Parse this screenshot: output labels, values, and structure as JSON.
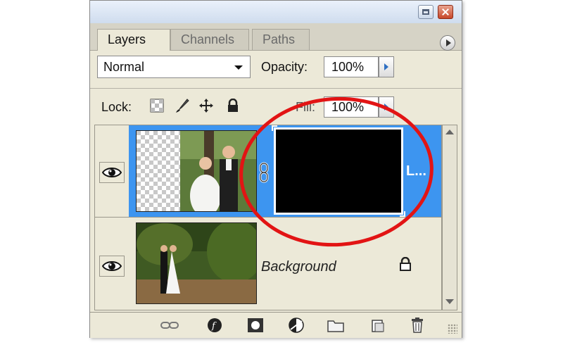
{
  "panel": {
    "tabs": [
      {
        "label": "Layers",
        "active": true
      },
      {
        "label": "Channels",
        "active": false
      },
      {
        "label": "Paths",
        "active": false
      }
    ]
  },
  "options": {
    "blend_mode": "Normal",
    "opacity_label": "Opacity:",
    "opacity_value": "100%",
    "lock_label": "Lock:",
    "fill_label": "Fill:",
    "fill_value": "100%"
  },
  "layers": [
    {
      "name": "L...",
      "visible": true,
      "selected": true,
      "has_mask": true,
      "thumbnail": "wedding-couple-transparent"
    },
    {
      "name": "Background",
      "visible": true,
      "selected": false,
      "locked": true,
      "thumbnail": "couple-walking-garden"
    }
  ],
  "bottom_icons": [
    "link-layers-icon",
    "layer-style-icon",
    "add-mask-icon",
    "adjustment-layer-icon",
    "new-group-icon",
    "new-layer-icon",
    "delete-layer-icon"
  ],
  "colors": {
    "selection": "#3d95f0",
    "annotation": "#e21414",
    "panel_bg": "#ece9d8"
  }
}
